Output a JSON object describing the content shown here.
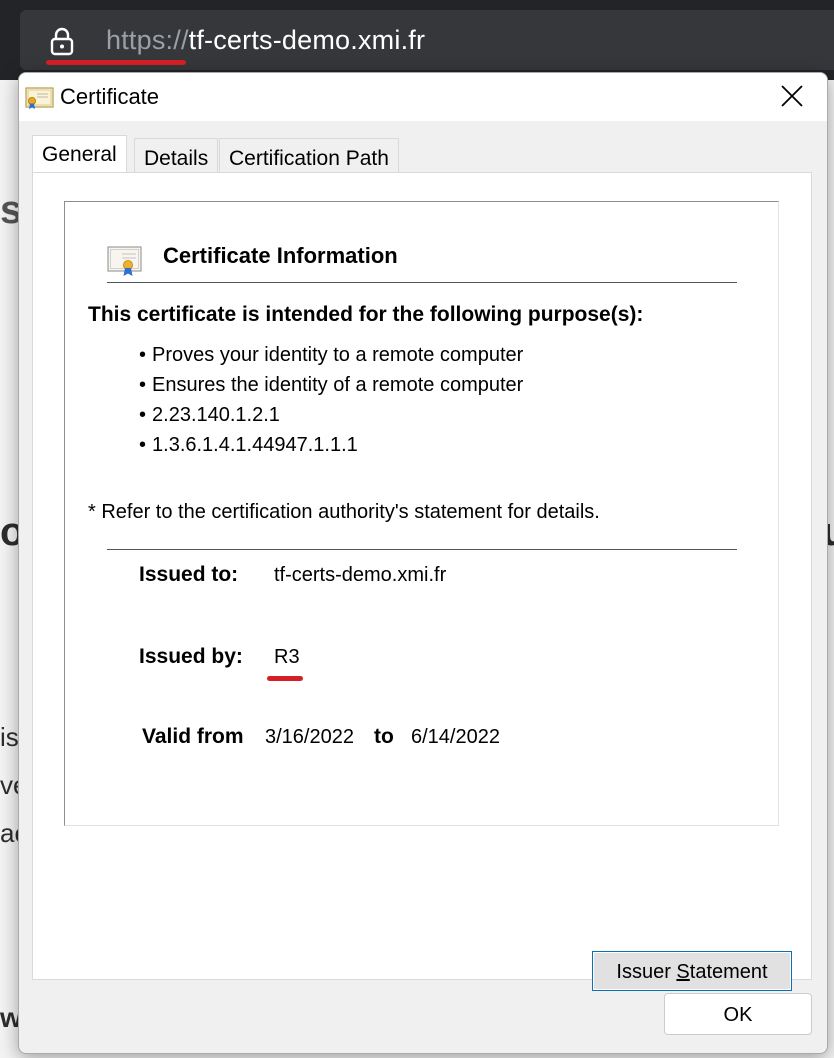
{
  "browser": {
    "url_scheme": "https://",
    "url_host": "tf-certs-demo.xmi.fr"
  },
  "background_fragments": {
    "frag1": "s",
    "frag2": "o",
    "frag3": "u",
    "frag4": "is",
    "frag5": "ve",
    "frag6": "ac",
    "frag7": "wi"
  },
  "dialog": {
    "title": "Certificate",
    "tabs": [
      "General",
      "Details",
      "Certification Path"
    ],
    "info_title": "Certificate Information",
    "purpose_heading": "This certificate is intended for the following purpose(s):",
    "purposes": [
      "Proves your identity to a remote computer",
      "Ensures the identity of a remote computer",
      "2.23.140.1.2.1",
      "1.3.6.1.4.1.44947.1.1.1"
    ],
    "refer_note": "* Refer to the certification authority's statement for details.",
    "issued_to_label": "Issued to:",
    "issued_to_value": "tf-certs-demo.xmi.fr",
    "issued_by_label": "Issued by:",
    "issued_by_value": "R3",
    "valid_from_label": "Valid from",
    "valid_from_value": "3/16/2022",
    "valid_to_label": "to",
    "valid_to_value": "6/14/2022",
    "issuer_statement_pre": "Issuer ",
    "issuer_statement_accel": "S",
    "issuer_statement_post": "tatement",
    "ok_label": "OK"
  },
  "colors": {
    "highlight_underline": "#d51f26",
    "focus_border": "#0f6fb3"
  }
}
